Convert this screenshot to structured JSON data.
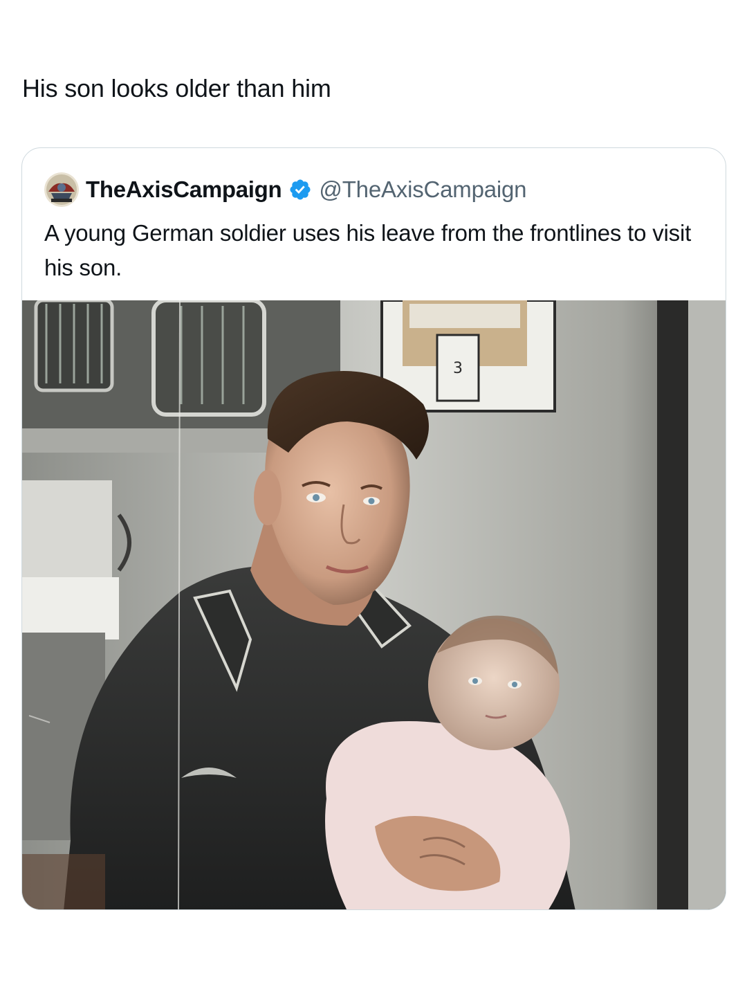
{
  "post": {
    "text": "His son looks older than him"
  },
  "quoted_tweet": {
    "display_name": "TheAxisCampaign",
    "handle": "@TheAxisCampaign",
    "verified": true,
    "text": "A young German soldier uses his leave from the frontlines to visit his son.",
    "media": {
      "calendar_number": "3"
    }
  },
  "icons": {
    "verified": "verified-badge-icon",
    "avatar": "profile-avatar"
  },
  "colors": {
    "text_primary": "#0f1419",
    "text_secondary": "#536471",
    "card_border": "#cfd9de",
    "verified_blue": "#1d9bf0"
  }
}
